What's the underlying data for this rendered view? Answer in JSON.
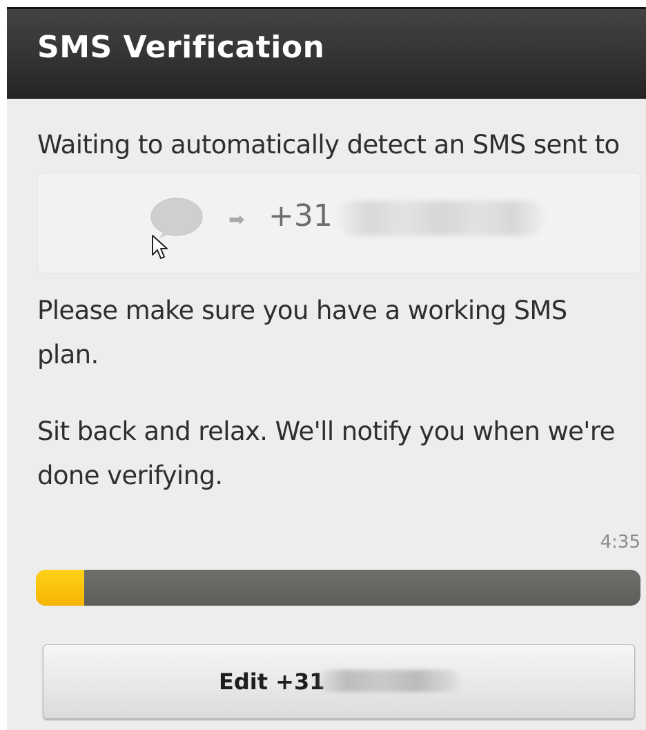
{
  "header": {
    "title": "SMS Verification"
  },
  "main": {
    "waiting_text": "Waiting to automatically detect an SMS sent to",
    "recipient": {
      "message_icon": "speech-bubble-icon",
      "arrow_icon": "arrow-right-icon",
      "arrow_glyph": "➡",
      "number_prefix": "+31"
    },
    "plan_text": "Please make sure you have a working SMS plan.",
    "relax_text": "Sit back and relax. We'll notify you when we're done verifying."
  },
  "countdown": {
    "time_remaining": "4:35",
    "progress_fraction": 0.08,
    "fill_color": "#f5b400",
    "track_color": "#5e605c"
  },
  "edit_button": {
    "label": "Edit +31"
  }
}
